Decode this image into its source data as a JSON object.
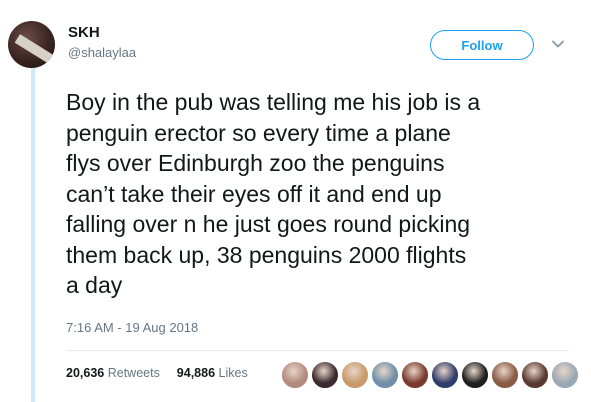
{
  "user": {
    "display_name": "SKH",
    "handle": "@shalaylaa",
    "avatar_icon": "profile-photo-avatar"
  },
  "follow_button": {
    "label": "Follow"
  },
  "more_menu": {
    "icon": "chevron-down-icon"
  },
  "tweet": {
    "text": "Boy in the pub was telling me his job is a\npenguin erector so every time a plane\nflys over Edinburgh zoo the penguins\ncan’t take their eyes off it and end up\nfalling over n he just goes round picking\nthem back up, 38 penguins 2000 flights\na day",
    "timestamp": "7:16 AM - 19 Aug 2018"
  },
  "stats": {
    "retweets_count": "20,636",
    "retweets_label": "Retweets",
    "likes_count": "94,886",
    "likes_label": "Likes"
  },
  "colors": {
    "accent": "#1da1f2",
    "secondary_text": "#657786",
    "thread_line": "#cfe9f6"
  },
  "liker_avatars": [
    {
      "name": "liker-avatar",
      "color": "#b38b7e"
    },
    {
      "name": "liker-avatar",
      "color": "#3b2a2e"
    },
    {
      "name": "liker-avatar",
      "color": "#c79a6a"
    },
    {
      "name": "liker-avatar",
      "color": "#6f8fa8"
    },
    {
      "name": "liker-avatar",
      "color": "#7a3b2e"
    },
    {
      "name": "liker-avatar",
      "color": "#2f3e6b"
    },
    {
      "name": "liker-avatar",
      "color": "#1f1f1f"
    },
    {
      "name": "liker-avatar",
      "color": "#8a5a44"
    },
    {
      "name": "liker-avatar",
      "color": "#5a3a30"
    },
    {
      "name": "liker-avatar",
      "color": "#9aa7b5"
    }
  ]
}
